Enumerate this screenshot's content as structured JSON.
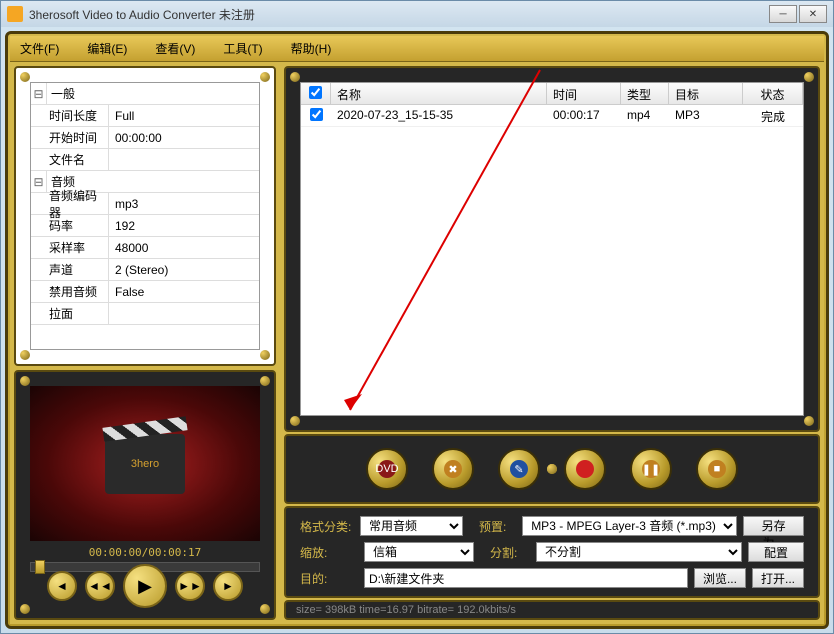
{
  "title": "3herosoft Video to Audio Converter 未注册",
  "menu": {
    "file": "文件(F)",
    "edit": "编辑(E)",
    "view": "查看(V)",
    "tools": "工具(T)",
    "help": "帮助(H)"
  },
  "propgroups": {
    "general": "一般",
    "audio": "音频"
  },
  "props": {
    "duration_label": "时间长度",
    "duration_value": "Full",
    "start_label": "开始时间",
    "start_value": "00:00:00",
    "filename_label": "文件名",
    "filename_value": "",
    "encoder_label": "音频编码器",
    "encoder_value": "mp3",
    "bitrate_label": "码率",
    "bitrate_value": "192",
    "samplerate_label": "采样率",
    "samplerate_value": "48000",
    "channel_label": "声道",
    "channel_value": "2 (Stereo)",
    "disable_label": "禁用音频",
    "disable_value": "False",
    "extra_label": "拉面"
  },
  "preview": {
    "brand": "3hero",
    "timecode": "00:00:00/00:00:17"
  },
  "filelist": {
    "headers": {
      "name": "名称",
      "time": "时间",
      "type": "类型",
      "target": "目标",
      "status": "状态"
    },
    "rows": [
      {
        "checked": true,
        "name": "2020-07-23_15-15-35",
        "time": "00:00:17",
        "type": "mp4",
        "target": "MP3",
        "status": "完成"
      }
    ]
  },
  "settings": {
    "format_label": "格式分类:",
    "format_value": "常用音频",
    "preset_label": "预置:",
    "preset_value": "MP3 - MPEG Layer-3 音频 (*.mp3)",
    "saveas": "另存为...",
    "zoom_label": "缩放:",
    "zoom_value": "信箱",
    "split_label": "分割:",
    "split_value": "不分割",
    "config": "配置",
    "dest_label": "目的:",
    "dest_value": "D:\\新建文件夹",
    "browse": "浏览...",
    "open": "打开..."
  },
  "status": "size=    398kB time=16.97 bitrate= 192.0kbits/s"
}
